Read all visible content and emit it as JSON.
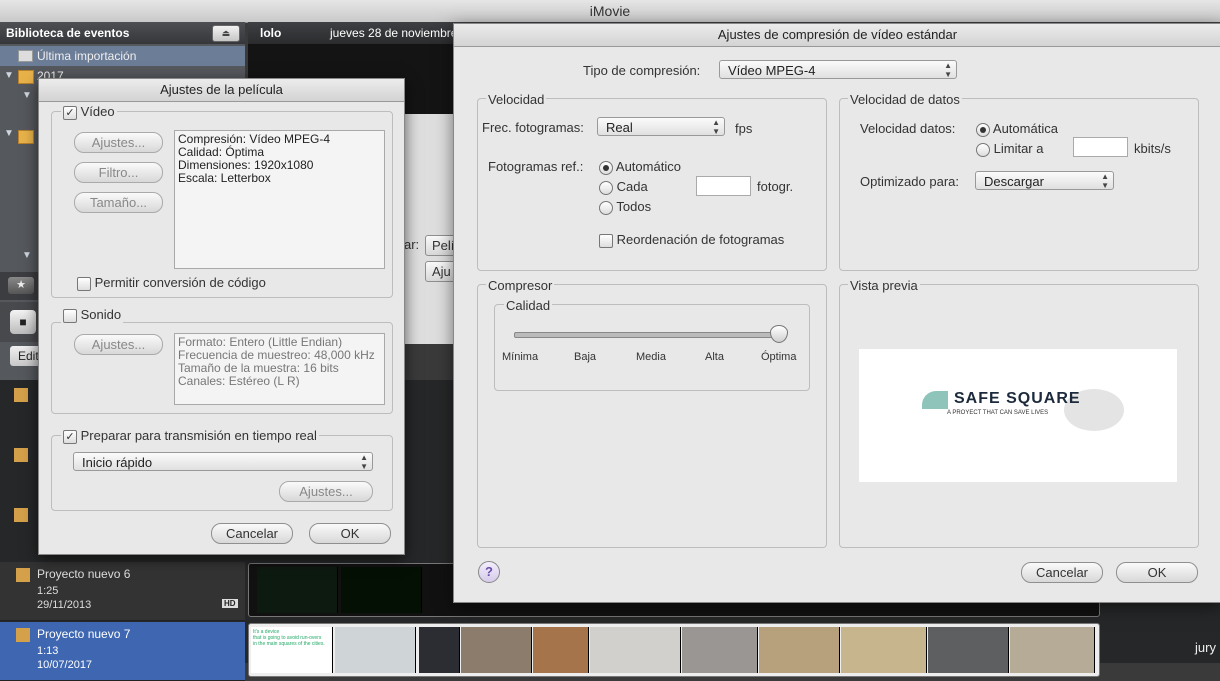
{
  "app": {
    "title": "iMovie"
  },
  "library": {
    "header": "Biblioteca de eventos",
    "rows": [
      {
        "label": "Última importación"
      },
      {
        "label": "2017"
      }
    ]
  },
  "event_bar": {
    "name": "lolo",
    "date": "jueves 28 de noviembre"
  },
  "hidden_fragments": {
    "pel": "Pelí",
    "aju": "Aju",
    "ar": "ar:",
    "edit": "Edit"
  },
  "projects": [
    {
      "name": "Proyecto nuevo 6",
      "duration": "1:25",
      "date": "29/11/2013",
      "badge": "HD"
    },
    {
      "name": "Proyecto nuevo 7",
      "duration": "1:13",
      "date": "10/07/2017"
    }
  ],
  "thumb_text": {
    "line1": "It's a device",
    "line2": "that is going to avoid run-overs",
    "line3": "in the main squares of the cities."
  },
  "corner_text": "jury",
  "movie_settings": {
    "title": "Ajustes de la película",
    "video": {
      "label": "Vídeo",
      "buttons": {
        "settings": "Ajustes...",
        "filter": "Filtro...",
        "size": "Tamaño..."
      },
      "info": "Compresión: Vídeo MPEG-4\nCalidad: Óptima\nDimensiones: 1920x1080\nEscala: Letterbox",
      "allow_transcode": "Permitir conversión de código"
    },
    "sound": {
      "label": "Sonido",
      "settings_button": "Ajustes...",
      "info": "Formato: Entero (Little Endian)\nFrecuencia de muestreo: 48,000 kHz\nTamaño de la muestra: 16 bits\nCanales: Estéreo (L R)"
    },
    "streaming": {
      "label": "Preparar para transmisión en tiempo real",
      "popup_value": "Inicio rápido",
      "settings_button": "Ajustes..."
    },
    "cancel": "Cancelar",
    "ok": "OK"
  },
  "compression": {
    "title": "Ajustes de compresión de vídeo estándar",
    "type_label": "Tipo de compresión:",
    "type_value": "Vídeo MPEG-4",
    "speed": {
      "label": "Velocidad",
      "fps_label": "Frec. fotogramas:",
      "fps_value": "Real",
      "fps_unit": "fps",
      "keyframes_label": "Fotogramas ref.:",
      "opt_auto": "Automático",
      "opt_every": "Cada",
      "every_unit": "fotogr.",
      "opt_all": "Todos",
      "reorder": "Reordenación de fotogramas"
    },
    "data_rate": {
      "label": "Velocidad de datos",
      "rate_label": "Velocidad datos:",
      "opt_auto": "Automática",
      "opt_limit": "Limitar a",
      "unit": "kbits/s",
      "optimized_label": "Optimizado para:",
      "optimized_value": "Descargar"
    },
    "compressor": {
      "label": "Compresor",
      "quality_label": "Calidad",
      "ticks": [
        "Mínima",
        "Baja",
        "Media",
        "Alta",
        "Óptima"
      ],
      "quality_value": 1.0
    },
    "preview": {
      "label": "Vista previa",
      "brand": "SAFE SQUARE",
      "tagline": "A PROYECT THAT CAN SAVE LIVES"
    },
    "help": "?",
    "cancel": "Cancelar",
    "ok": "OK"
  }
}
